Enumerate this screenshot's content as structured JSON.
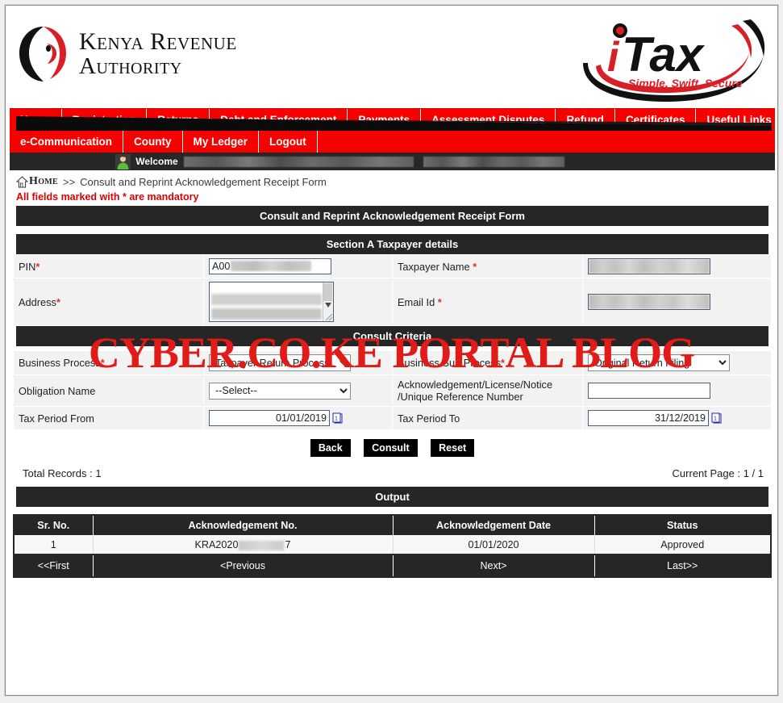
{
  "brand": {
    "kra_line1": "Kenya Revenue",
    "kra_line2": "Authority",
    "itax_name": "iTax",
    "itax_tagline": "Simple, Swift, Secure",
    "accent_red": "#f60000",
    "header_dark": "#262626"
  },
  "nav": {
    "row1": [
      {
        "label": "Home"
      },
      {
        "label": "Registration"
      },
      {
        "label": "Returns"
      },
      {
        "label": "Debt and Enforcement"
      },
      {
        "label": "Payments"
      },
      {
        "label": "Assessment Disputes"
      },
      {
        "label": "Refund"
      },
      {
        "label": "Certificates"
      },
      {
        "label": "Useful Links"
      }
    ],
    "row2": [
      {
        "label": "e-Communication"
      },
      {
        "label": "County"
      },
      {
        "label": "My Ledger"
      },
      {
        "label": "Logout"
      }
    ]
  },
  "welcome": {
    "label": "Welcome",
    "user_name": "",
    "user_extra": ""
  },
  "breadcrumb": {
    "home": "Home",
    "separator": ">>",
    "current": "Consult and Reprint Acknowledgement Receipt Form"
  },
  "notice": {
    "mandatory_text": "All fields marked with * are mandatory"
  },
  "page_title": "Consult and Reprint Acknowledgement Receipt Form",
  "section_a": {
    "title": "Section A Taxpayer details",
    "pin_label": "PIN",
    "pin_value": "A00",
    "taxpayer_name_label": "Taxpayer Name",
    "taxpayer_name_value": "",
    "address_label": "Address",
    "address_value": "",
    "email_label": "Email Id",
    "email_value": ""
  },
  "consult_criteria": {
    "title": "Consult Criteria",
    "business_process_label": "Business Process",
    "business_process_value": "Taxpayer Return Processi",
    "business_sub_process_label": "Business Sub Process",
    "business_sub_process_value": "Original Return Filing",
    "obligation_name_label": "Obligation Name",
    "obligation_name_value": "--Select--",
    "ack_number_label": "Acknowledgement/License/Notice /Unique Reference Number",
    "ack_number_label_line1": "Acknowledgement/License/Notice",
    "ack_number_label_line2": "/Unique Reference Number",
    "ack_number_value": "",
    "tax_period_from_label": "Tax Period From",
    "tax_period_from_value": "01/01/2019",
    "tax_period_to_label": "Tax Period To",
    "tax_period_to_value": "31/12/2019",
    "calendar_icon": "calendar-icon"
  },
  "buttons": {
    "back": "Back",
    "consult": "Consult",
    "reset": "Reset"
  },
  "records": {
    "total_label": "Total Records : 1",
    "current_page_label": "Current Page : 1 / 1"
  },
  "output": {
    "title": "Output",
    "columns": [
      "Sr. No.",
      "Acknowledgement No.",
      "Acknowledgement Date",
      "Status"
    ],
    "rows": [
      {
        "sr_no": "1",
        "ack_no_prefix": "KRA2020",
        "ack_no_suffix": "7",
        "ack_date": "01/01/2020",
        "status": "Approved"
      }
    ],
    "pagination": [
      "<<First",
      "<Previous",
      "Next>",
      "Last>>"
    ]
  },
  "watermark": {
    "text": "CYBER.CO.KE PORTAL BLOG",
    "color": "#e11b17"
  }
}
